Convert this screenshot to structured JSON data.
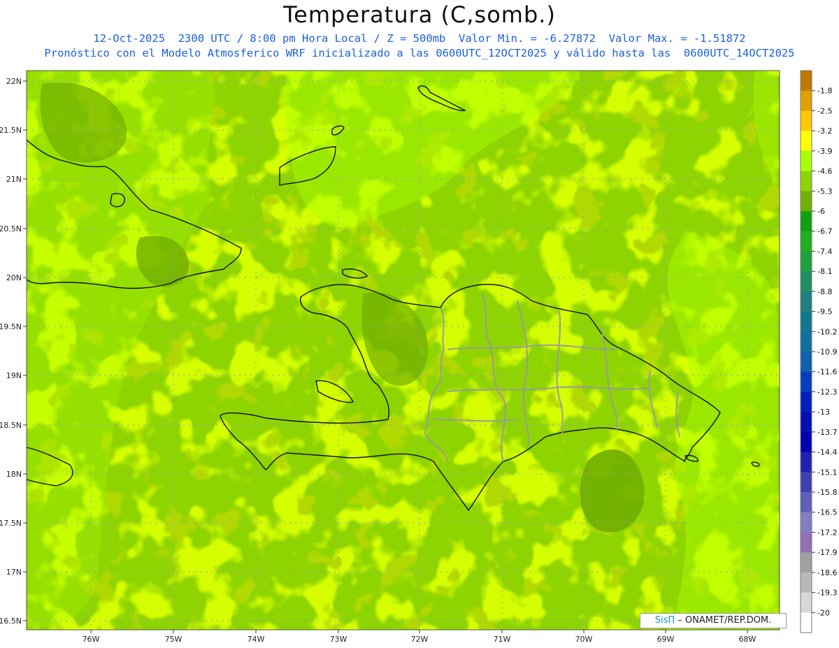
{
  "header": {
    "title": "Temperatura (C,somb.)",
    "subtitle1": "12-Oct-2025  2300 UTC / 8:00 pm Hora Local / Z = 500mb  Valor Min. = -6.27872  Valor Max. = -1.51872",
    "subtitle2": "Pronóstico con el Modelo Atmosferico WRF inicializado a las 0600UTC_12OCT2025 y válido hasta las  0600UTC_14OCT2025"
  },
  "map": {
    "lat_labels": [
      "22N",
      "21.5N",
      "21N",
      "20.5N",
      "20N",
      "19.5N",
      "19N",
      "18.5N",
      "18N",
      "17.5N",
      "17N",
      "16.5N"
    ],
    "lon_labels": [
      "76W",
      "75W",
      "74W",
      "73W",
      "72W",
      "71W",
      "70W",
      "69W",
      "68W"
    ],
    "base_color": "#8ed400",
    "light_color": "#aaff00",
    "dark_color": "#70b000"
  },
  "colorbar": {
    "labels": [
      "-1.8",
      "-2.5",
      "-3.2",
      "-3.9",
      "-4.6",
      "-5.3",
      "-6",
      "-6.7",
      "-7.4",
      "-8.1",
      "-8.8",
      "-9.5",
      "-10.2",
      "-10.9",
      "-11.6",
      "-12.3",
      "-13",
      "-13.7",
      "-14.4",
      "-15.1",
      "-15.8",
      "-16.5",
      "-17.2",
      "-17.9",
      "-18.6",
      "-19.3",
      "-20"
    ],
    "colors": [
      "#c07800",
      "#e0a000",
      "#ffc800",
      "#ffff00",
      "#aaff00",
      "#8ed400",
      "#70b000",
      "#10a010",
      "#20b020",
      "#20a040",
      "#209060",
      "#208080",
      "#107890",
      "#1070a0",
      "#1060b0",
      "#0040c0",
      "#0020c0",
      "#0010b0",
      "#0000b0",
      "#2020b0",
      "#4040b0",
      "#6060b8",
      "#8080c0",
      "#9070b0",
      "#a0a0a0",
      "#b8b8b8",
      "#d8d8d8",
      "#ffffff"
    ]
  },
  "credit": {
    "brand": "SisΠ",
    "text": "– ONAMET/REP.DOM."
  }
}
